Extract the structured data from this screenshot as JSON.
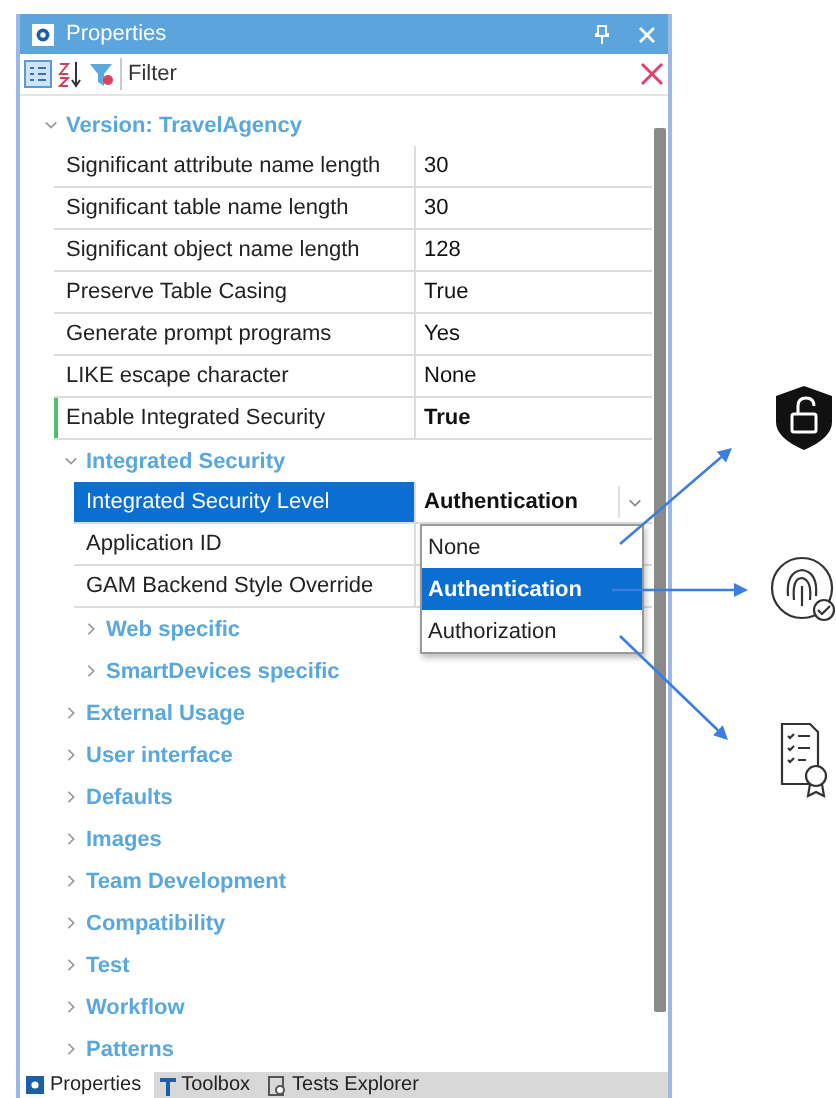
{
  "window": {
    "title": "Properties"
  },
  "toolbar": {
    "filter": {
      "placeholder": "Filter"
    }
  },
  "tree": [
    {
      "kind": "group",
      "label": "Version: TravelAgency",
      "expanded": true,
      "children": [
        {
          "kind": "property",
          "name": "Significant attribute name length",
          "value": "30",
          "modified": false,
          "selected": false
        },
        {
          "kind": "property",
          "name": "Significant table name length",
          "value": "30",
          "modified": false,
          "selected": false
        },
        {
          "kind": "property",
          "name": "Significant object name length",
          "value": "128",
          "modified": false,
          "selected": false
        },
        {
          "kind": "property",
          "name": "Preserve Table Casing",
          "value": "True",
          "modified": false,
          "selected": false
        },
        {
          "kind": "property",
          "name": "Generate prompt programs",
          "value": "Yes",
          "modified": false,
          "selected": false
        },
        {
          "kind": "property",
          "name": "LIKE escape character",
          "value": "None",
          "modified": false,
          "selected": false
        },
        {
          "kind": "property",
          "name": "Enable Integrated Security",
          "value": "True",
          "modified": true,
          "selected": false
        },
        {
          "kind": "group",
          "label": "Integrated Security",
          "expanded": true,
          "children": [
            {
              "kind": "property",
              "name": "Integrated Security Level",
              "value": "Authentication",
              "modified": false,
              "selected": true,
              "dropdown": [
                {
                  "label": "None",
                  "selected": false
                },
                {
                  "label": "Authentication",
                  "selected": true
                },
                {
                  "label": "Authorization",
                  "selected": false
                }
              ]
            },
            {
              "kind": "property",
              "name": "Application ID",
              "modified": false,
              "selected": false
            },
            {
              "kind": "property",
              "name": "GAM Backend Style Override",
              "modified": false,
              "selected": false
            },
            {
              "kind": "group",
              "label": "Web specific",
              "expanded": false
            },
            {
              "kind": "group",
              "label": "SmartDevices specific",
              "expanded": false
            }
          ]
        },
        {
          "kind": "group",
          "label": "External Usage",
          "expanded": false
        },
        {
          "kind": "group",
          "label": "User interface",
          "expanded": false
        },
        {
          "kind": "group",
          "label": "Defaults",
          "expanded": false
        },
        {
          "kind": "group",
          "label": "Images",
          "expanded": false
        },
        {
          "kind": "group",
          "label": "Team Development",
          "expanded": false
        },
        {
          "kind": "group",
          "label": "Compatibility",
          "expanded": false
        },
        {
          "kind": "group",
          "label": "Test",
          "expanded": false
        },
        {
          "kind": "group",
          "label": "Workflow",
          "expanded": false
        },
        {
          "kind": "group",
          "label": "Patterns",
          "expanded": false
        }
      ]
    }
  ],
  "bottom_tabs": [
    {
      "label": "Properties",
      "selected": true
    },
    {
      "label": "Toolbox",
      "selected": false
    },
    {
      "label": "Tests Explorer",
      "selected": false
    }
  ]
}
